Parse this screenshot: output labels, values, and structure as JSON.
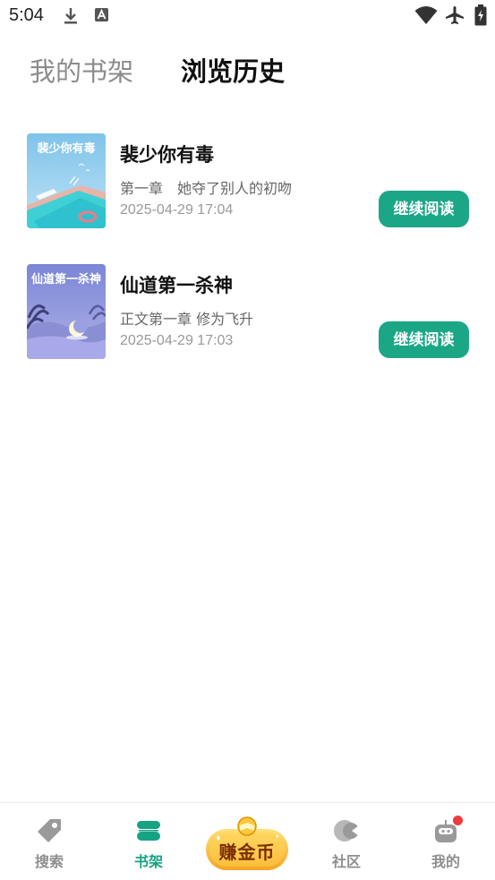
{
  "status_bar": {
    "time": "5:04",
    "icons": [
      "download-icon",
      "a-letter-icon",
      "wifi-icon",
      "airplane-icon",
      "battery-charging-icon"
    ]
  },
  "tabs": {
    "shelf_label": "我的书架",
    "history_label": "浏览历史",
    "active": "浏览历史"
  },
  "history": [
    {
      "cover_text": "裴少你有毒",
      "title": "裴少你有毒",
      "chapter": "第一章　她夺了别人的初吻",
      "time": "2025-04-29 17:04",
      "button": "继续阅读"
    },
    {
      "cover_text": "仙道第一杀神",
      "title": "仙道第一杀神",
      "chapter": "正文第一章 修为飞升",
      "time": "2025-04-29 17:03",
      "button": "继续阅读"
    }
  ],
  "bottom_nav": {
    "search": "搜索",
    "shelf": "书架",
    "earn_coins": "赚金币",
    "community": "社区",
    "mine": "我的",
    "active": "书架"
  },
  "colors": {
    "accent": "#1ba786",
    "active_nav": "#15a382",
    "inactive_nav": "#8e8e8e",
    "badge": "#f0393f"
  }
}
